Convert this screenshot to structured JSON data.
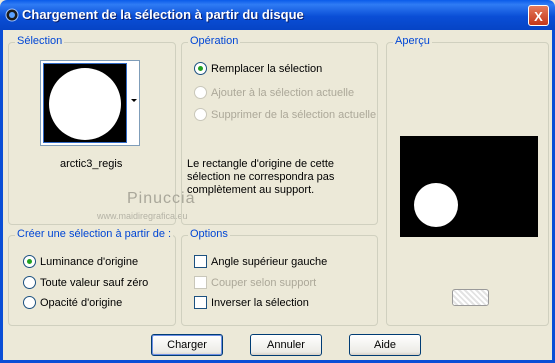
{
  "window": {
    "title": "Chargement de la sélection à partir du disque",
    "close_glyph": "X"
  },
  "selection_group": {
    "legend": "Sélection",
    "file_name": "arctic3_regis"
  },
  "operation_group": {
    "legend": "Opération",
    "options": [
      {
        "label": "Remplacer la sélection",
        "selected": true,
        "enabled": true
      },
      {
        "label": "Ajouter à la sélection actuelle",
        "selected": false,
        "enabled": false
      },
      {
        "label": "Supprimer de la sélection actuelle",
        "selected": false,
        "enabled": false
      }
    ],
    "note": "Le rectangle d'origine de cette sélection ne correspondra pas complètement au support."
  },
  "preview_group": {
    "legend": "Aperçu"
  },
  "create_group": {
    "legend": "Créer une sélection à partir de :",
    "options": [
      {
        "label": "Luminance d'origine",
        "selected": true
      },
      {
        "label": "Toute valeur sauf zéro",
        "selected": false
      },
      {
        "label": "Opacité d'origine",
        "selected": false
      }
    ]
  },
  "options_group": {
    "legend": "Options",
    "checkboxes": [
      {
        "label": "Angle supérieur gauche",
        "checked": false,
        "enabled": true
      },
      {
        "label": "Couper selon support",
        "checked": false,
        "enabled": false
      },
      {
        "label": "Inverser la sélection",
        "checked": false,
        "enabled": true
      }
    ]
  },
  "buttons": {
    "load": "Charger",
    "cancel": "Annuler",
    "help": "Aide"
  },
  "watermark": {
    "line1": "Pinuccia",
    "line2": "www.maidiregrafica.eu"
  },
  "colors": {
    "title_bar": "#0A4ED6",
    "dialog_bg": "#ECE9D8",
    "legend_text": "#0046D5",
    "radio_dot": "#21A121"
  }
}
